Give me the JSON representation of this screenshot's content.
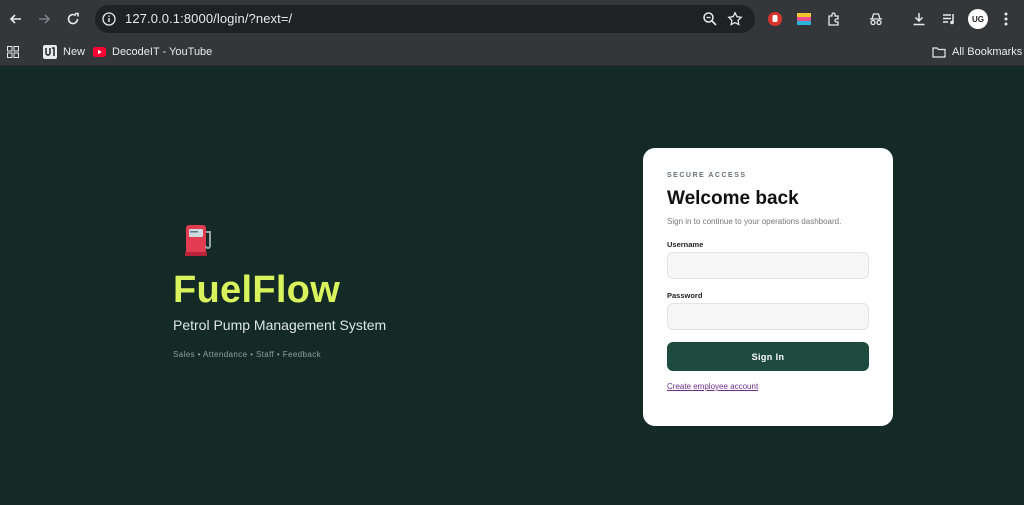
{
  "browser": {
    "url": "127.0.0.1:8000/login/?next=/",
    "profile_initials": "UG",
    "bookmarks": [
      {
        "label": "New",
        "icon": "uq-icon"
      },
      {
        "label": "DecodeIT - YouTube",
        "icon": "youtube-icon"
      }
    ],
    "all_bookmarks_label": "All Bookmarks"
  },
  "hero": {
    "brand": "FuelFlow",
    "tagline": "Petrol Pump Management System",
    "features": "Sales • Attendance • Staff • Feedback",
    "icon": "fuel-pump-icon"
  },
  "login": {
    "eyebrow": "SECURE ACCESS",
    "title": "Welcome back",
    "subtitle": "Sign in to continue to your operations dashboard.",
    "username_label": "Username",
    "username_value": "",
    "password_label": "Password",
    "password_value": "",
    "sign_in_label": "Sign In",
    "create_account_label": "Create employee account"
  },
  "colors": {
    "page_bg": "#132a26",
    "brand": "#d9f35c",
    "button": "#1f4a3e",
    "link": "#6b2e8a"
  }
}
